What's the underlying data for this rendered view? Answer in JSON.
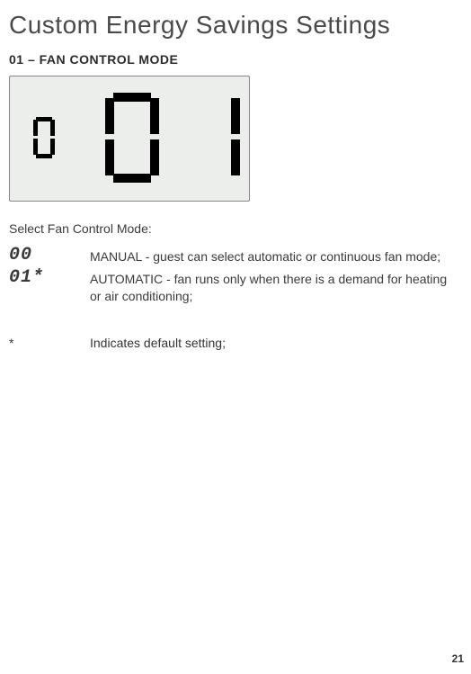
{
  "title": "Custom Energy Savings Settings",
  "section_label": "01 – FAN CONTROL MODE",
  "lcd": {
    "small_digit": "0",
    "big_left_digit": "0",
    "big_right_digit": "1"
  },
  "lead_text": "Select Fan Control Mode:",
  "options": [
    {
      "code": "00",
      "description": "MANUAL - guest can select automatic or continuous fan mode;"
    },
    {
      "code": "01*",
      "description": "AUTOMATIC - fan runs only when there is a demand for heating or air conditioning;"
    }
  ],
  "footnote": {
    "mark": "*",
    "text": "Indicates default setting;"
  },
  "page_number": "21"
}
